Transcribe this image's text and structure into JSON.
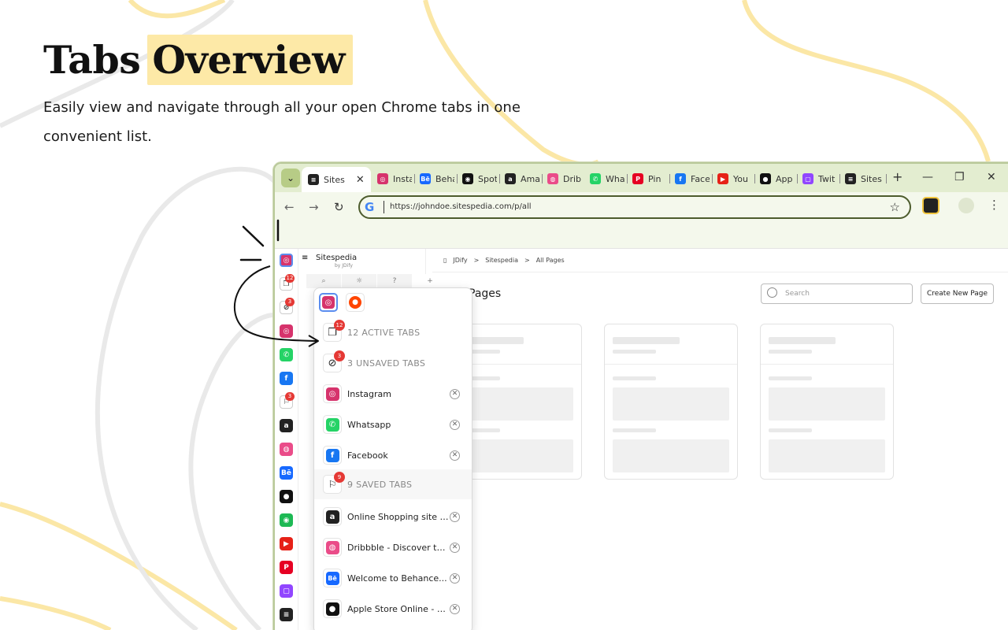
{
  "hero": {
    "title_plain": "Tabs",
    "title_highlight": "Overview",
    "subtitle": "Easily view and navigate through all your open Chrome tabs in one convenient list."
  },
  "colors": {
    "highlight": "#fde9a7",
    "tabstrip": "#e3edd0",
    "badge": "#e53935",
    "accent_lines": "#fbe7a6"
  },
  "browser": {
    "tabs": [
      {
        "label": "Sites",
        "icon": "sitespedia-icon",
        "active": true
      },
      {
        "label": "Insta",
        "icon": "instagram-icon"
      },
      {
        "label": "Beha",
        "icon": "behance-icon"
      },
      {
        "label": "Spot",
        "icon": "spotify-icon"
      },
      {
        "label": "Ama",
        "icon": "amazon-icon"
      },
      {
        "label": "Drib",
        "icon": "dribbble-icon"
      },
      {
        "label": "Wha",
        "icon": "whatsapp-icon"
      },
      {
        "label": "Pin",
        "icon": "pinterest-icon"
      },
      {
        "label": "Face",
        "icon": "facebook-icon"
      },
      {
        "label": "You",
        "icon": "youtube-icon"
      },
      {
        "label": "App",
        "icon": "apple-icon"
      },
      {
        "label": "Twit",
        "icon": "twitch-icon"
      },
      {
        "label": "Sites",
        "icon": "sitespedia-icon"
      }
    ],
    "new_tab": "+",
    "minimize": "—",
    "restore": "❐",
    "close": "✕",
    "url": "https://johndoe.sitespedia.com/p/all",
    "back": "←",
    "forward": "→",
    "reload": "↻",
    "star": "☆",
    "menu": "⋮"
  },
  "side_panel": {
    "site_name": "Sitespedia",
    "site_by": "by JDify",
    "rail_badges": {
      "active": "12",
      "unsaved": "3",
      "saved": "3"
    }
  },
  "page": {
    "breadcrumb": [
      "JDify",
      ">",
      "Sitespedia",
      ">",
      "All Pages"
    ],
    "heading": "Pages",
    "search_placeholder": "Search",
    "new_page_button": "Create New Page"
  },
  "popup": {
    "active_tabs": {
      "label": "12 ACTIVE TABS",
      "badge": "12"
    },
    "unsaved_tabs": {
      "label": "3 UNSAVED TABS",
      "badge": "3"
    },
    "unsaved_items": [
      {
        "label": "Instagram",
        "icon": "instagram-icon"
      },
      {
        "label": "Whatsapp",
        "icon": "whatsapp-icon"
      },
      {
        "label": "Facebook",
        "icon": "facebook-icon"
      }
    ],
    "saved_tabs": {
      "label": "9 SAVED TABS",
      "badge": "9"
    },
    "saved_items": [
      {
        "label": "Online Shopping site in...",
        "icon": "amazon-icon"
      },
      {
        "label": "Dribbble - Discover th...",
        "icon": "dribbble-icon"
      },
      {
        "label": "Welcome to Behance...",
        "icon": "behance-icon"
      },
      {
        "label": "Apple Store Online - Ap...",
        "icon": "apple-icon"
      }
    ]
  }
}
